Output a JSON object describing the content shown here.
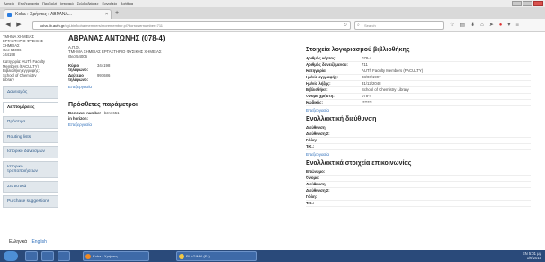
{
  "browser": {
    "menu_items": [
      "Αρχείο",
      "Επεξεργασία",
      "Προβολή",
      "Ιστορικό",
      "Σελιδοδείκτες",
      "Εργαλεία",
      "Βοήθεια"
    ],
    "tab_title": "Koha › Χρήστες › ΑΒΡΑΝΑ...",
    "url_host": "koha.lib.auth.gr",
    "url_path": "/cgi-bin/koha/members/moremember.pl?borrowernumber=711",
    "search_placeholder": "Search"
  },
  "sidebar": {
    "info_lines": [
      "ΤΜΗΜΑ ΧΗΜΕΙΑΣ",
      "ΕΡΓΑΣΤΗΡΙΟ ΦΥΣΙΚΗΣ",
      "ΧΗΜΕΙΑΣ",
      "Θεσ 54006",
      "344198",
      "",
      "Κατηγορία: AUTh Faculty",
      "Members (FACULTY)",
      "Βιβλιοθήκη εγγραφής:",
      "School of Chemistry",
      "Library"
    ],
    "items": [
      {
        "label": "Δανεισμός",
        "active": false
      },
      {
        "label": "Λεπτομέρειες",
        "active": true
      },
      {
        "label": "Πρόστιμα",
        "active": false
      },
      {
        "label": "Routing lists",
        "active": false
      },
      {
        "label": "Ιστορικό δανεισμών",
        "active": false
      },
      {
        "label": "Ιστορικό τροποποιήσεων",
        "active": false
      },
      {
        "label": "Στατιστικά",
        "active": false
      },
      {
        "label": "Purchase suggestions",
        "active": false
      }
    ]
  },
  "main": {
    "title": "ΑΒΡΑΝΑΣ ΑΝΤΩΝΗΣ (078-4)",
    "address_lines": [
      "Α.Π.Θ.",
      "ΤΜΗΜΑ ΧΗΜΕΙΑΣ ΕΡΓΑΣΤΗΡΙΟ ΦΥΣΙΚΗΣ ΧΗΜΕΙΑΣ",
      "Θεσ 54006"
    ],
    "phones": [
      {
        "label": "Κύριο τηλέφωνο:",
        "value": "344198"
      },
      {
        "label": "Δεύτερο τηλέφωνο:",
        "value": "997686"
      }
    ],
    "edit_label": "Επεξεργασία",
    "extra_title": "Πρόσθετες παράμετροι",
    "extra_field": {
      "label": "Borrower number in horizon:",
      "value": "bzn1651"
    },
    "extra_edit_label": "Επεξεργασία"
  },
  "right": {
    "account_title": "Στοιχεία λογαριασμού βιβλιοθήκης",
    "account_rows": [
      {
        "label": "Αριθμός κάρτας:",
        "value": "078-4"
      },
      {
        "label": "Αριθμός δανειζόμενου:",
        "value": "711"
      },
      {
        "label": "Κατηγορία:",
        "value": "AUTh Faculty Members (FACULTY)"
      },
      {
        "label": "Ημ/νία εγγραφής:",
        "value": "03/06/1997"
      },
      {
        "label": "Ημ/νία λήξης:",
        "value": "31/12/2048"
      },
      {
        "label": "Βιβλιοθήκη:",
        "value": "School of Chemistry Library"
      },
      {
        "label": "Όνομα χρήστη:",
        "value": "078-4"
      },
      {
        "label": "Κωδικός:",
        "value": "*******"
      }
    ],
    "account_edit_label": "Επεξεργασία",
    "alt_address_title": "Εναλλακτική διεύθυνση",
    "alt_address_rows": [
      {
        "label": "Διεύθυνση:",
        "value": ""
      },
      {
        "label": "Διεύθυνση 2:",
        "value": ""
      },
      {
        "label": "Πόλη:",
        "value": ""
      },
      {
        "label": "Τ.Κ.:",
        "value": ""
      }
    ],
    "alt_address_edit_label": "Επεξεργασία",
    "alt_contact_title": "Εναλλακτικά στοιχεία επικοινωνίας",
    "alt_contact_rows": [
      {
        "label": "Επώνυμο:",
        "value": ""
      },
      {
        "label": "Όνομα:",
        "value": ""
      },
      {
        "label": "Διεύθυνση:",
        "value": ""
      },
      {
        "label": "Διεύθυνση 2:",
        "value": ""
      },
      {
        "label": "Πόλη:",
        "value": ""
      },
      {
        "label": "Τ.Κ.:",
        "value": ""
      }
    ]
  },
  "footer": {
    "lang_current": "Ελληνικά",
    "lang_other": "English"
  },
  "taskbar": {
    "apps": [
      {
        "label": "Koha › Χρήστες ..."
      },
      {
        "label": "PLAGIMO (E:)"
      }
    ],
    "tray_lang": "EN",
    "time": "5:01 μμ",
    "date": "1/6/2015"
  },
  "colors": {
    "link": "#2f6fba",
    "nav_bg": "#e1e7ec",
    "taskbar": "#2a4a7a"
  }
}
